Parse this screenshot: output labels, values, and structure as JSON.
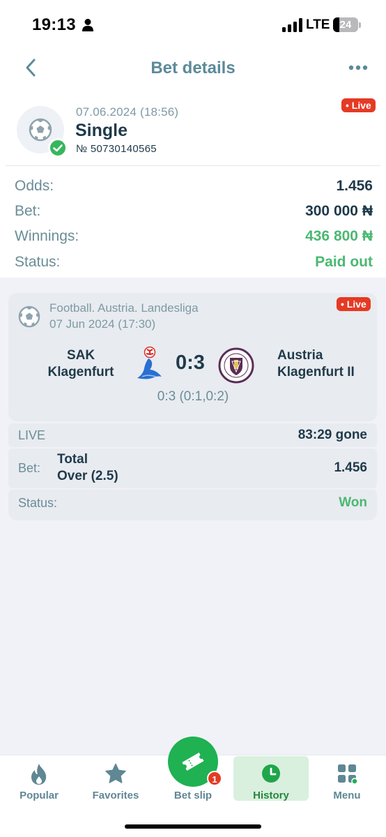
{
  "status_bar": {
    "time": "19:13",
    "network": "LTE",
    "battery": "24",
    "battery_level": 0.24
  },
  "header": {
    "title": "Bet details"
  },
  "bet": {
    "date": "07.06.2024 (18:56)",
    "type": "Single",
    "number": "№ 50730140565",
    "live_label": "• Live",
    "settled": true
  },
  "summary": [
    {
      "label": "Odds:",
      "value": "1.456",
      "highlight": false
    },
    {
      "label": "Bet:",
      "value": "300 000 ₦",
      "highlight": false
    },
    {
      "label": "Winnings:",
      "value": "436 800 ₦",
      "highlight": true
    },
    {
      "label": "Status:",
      "value": "Paid out",
      "highlight": true
    }
  ],
  "event": {
    "league": "Football. Austria. Landesliga",
    "date": "07 Jun 2024 (17:30)",
    "live_label": "• Live",
    "home_team_line1": "SAK",
    "home_team_line2": "Klagenfurt",
    "away_team_line1": "Austria",
    "away_team_line2": "Klagenfurt II",
    "score": "0:3",
    "score_detail": "0:3 (0:1,0:2)",
    "period_label": "LIVE",
    "period_time": "83:29 gone",
    "bet_label": "Bet:",
    "bet_market_line1": "Total",
    "bet_market_line2": "Over (2.5)",
    "bet_odds": "1.456",
    "status_label": "Status:",
    "status_value": "Won"
  },
  "nav": {
    "popular": "Popular",
    "favorites": "Favorites",
    "betslip": "Bet slip",
    "betslip_count": "1",
    "history": "History",
    "menu": "Menu",
    "active": "history"
  },
  "colors": {
    "accent_green": "#1fb152",
    "win_green": "#4bb872",
    "live_red": "#e53a24",
    "title_teal": "#5c8a99",
    "text_dark": "#1f3a4a"
  }
}
